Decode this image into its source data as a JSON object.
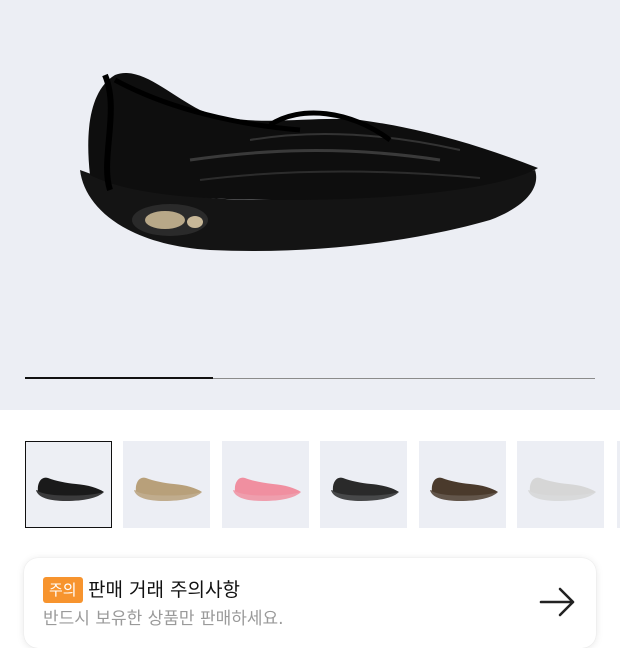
{
  "gallery": {
    "main_image": "black-sneaker-product-photo",
    "progress_fraction": 0.33,
    "thumbnails": [
      {
        "name": "black",
        "color": "#1a1a1a",
        "selected": true
      },
      {
        "name": "beige",
        "color": "#b8a07a",
        "selected": false
      },
      {
        "name": "pink",
        "color": "#f08fa0",
        "selected": false
      },
      {
        "name": "black-white",
        "color": "#2a2a2a",
        "selected": false
      },
      {
        "name": "brown",
        "color": "#4a3a2c",
        "selected": false
      },
      {
        "name": "silver",
        "color": "#d6d6d6",
        "selected": false
      }
    ]
  },
  "notice": {
    "badge": "주의",
    "title": "판매 거래 주의사항",
    "subtitle": "반드시 보유한 상품만 판매하세요.",
    "arrow_icon": "arrow-right-icon"
  },
  "colors": {
    "accent": "#f7942e",
    "hero_bg": "#eceef4"
  }
}
